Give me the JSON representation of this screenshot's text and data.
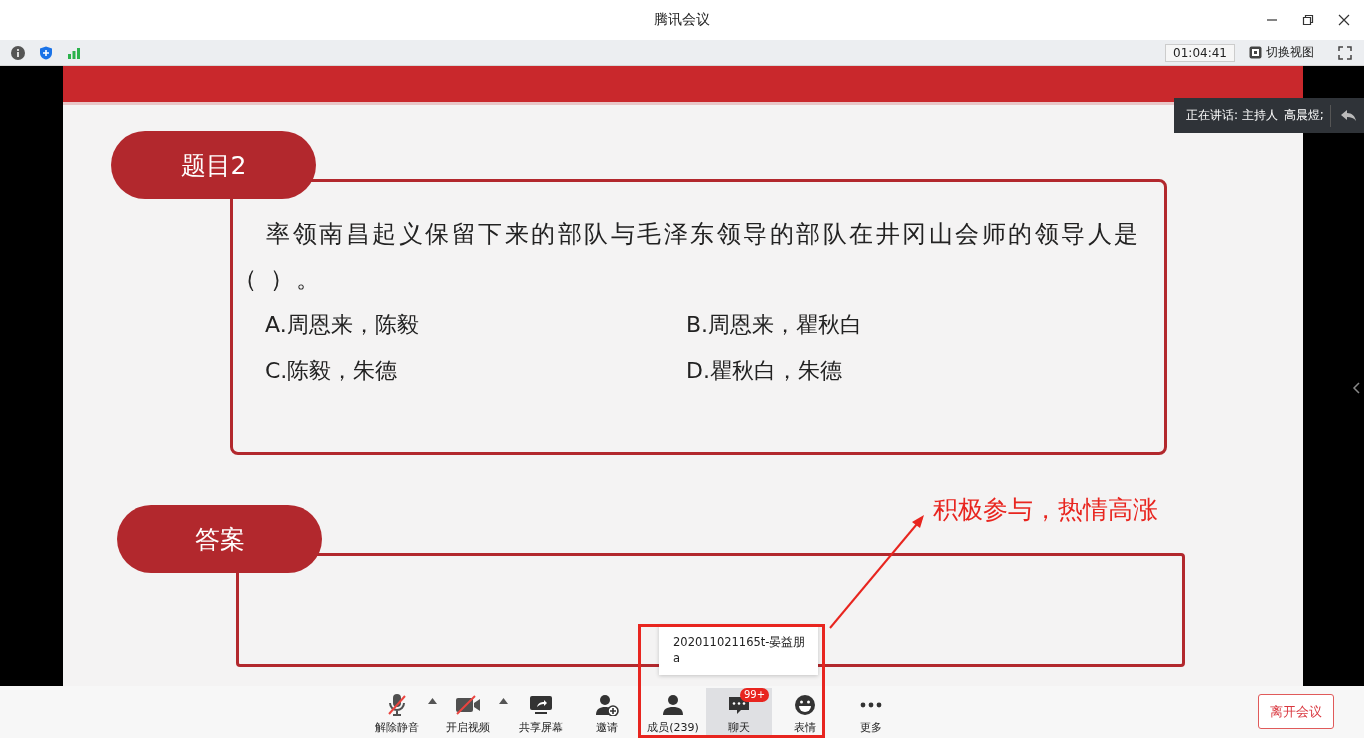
{
  "window": {
    "title": "腾讯会议"
  },
  "info_bar": {
    "timer": "01:04:41",
    "view_switch": "切换视图"
  },
  "speaker": {
    "label": "正在讲话: 主持人",
    "name": "高晨煜;"
  },
  "slide": {
    "question_tag": "题目2",
    "question": "率领南昌起义保留下来的部队与毛泽东领导的部队在井冈山会师的领导人是（ ）。",
    "options": [
      "A.周恩来，陈毅",
      "B.周恩来，瞿秋白",
      "C.陈毅，朱德",
      "D.瞿秋白，朱德"
    ],
    "answer_tag": "答案"
  },
  "annotation": "积极参与，热情高涨",
  "tooltip": "202011021165t-晏益朋a",
  "toolbar": [
    {
      "kind": "mic",
      "label": "解除静音",
      "off": true,
      "menu": true,
      "selected": false
    },
    {
      "kind": "video",
      "label": "开启视频",
      "off": true,
      "menu": true,
      "selected": false
    },
    {
      "kind": "share",
      "label": "共享屏幕",
      "selected": false
    },
    {
      "kind": "invite",
      "label": "邀请",
      "selected": false
    },
    {
      "kind": "members",
      "label": "成员(239)",
      "selected": false
    },
    {
      "kind": "chat",
      "label": "聊天",
      "selected": true,
      "badge": "99+"
    },
    {
      "kind": "emoji",
      "label": "表情",
      "selected": false
    },
    {
      "kind": "more",
      "label": "更多",
      "selected": false
    }
  ],
  "leave_button": "离开会议"
}
